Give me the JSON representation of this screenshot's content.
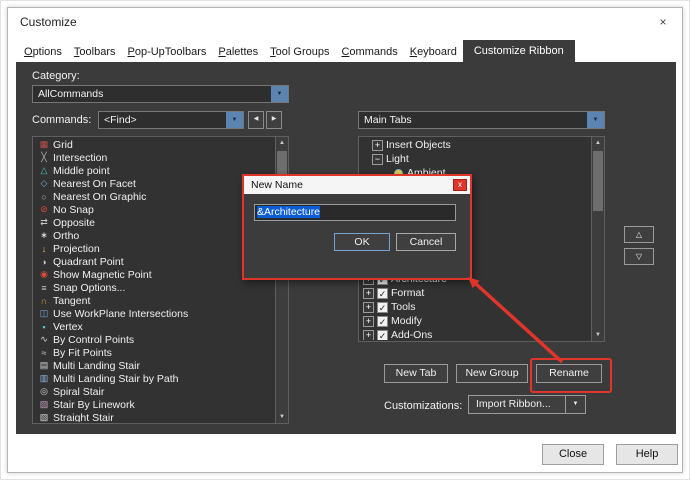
{
  "window": {
    "title": "Customize",
    "close_glyph": "×"
  },
  "tabs": {
    "inactive": [
      "Options",
      "Toolbars",
      "Pop-UpToolbars",
      "Palettes",
      "Tool Groups",
      "Commands",
      "Keyboard"
    ],
    "active": "Customize Ribbon"
  },
  "icons": {
    "drop": "▼",
    "prev": "◀",
    "next": "▶",
    "scroll_up": "▲",
    "scroll_down": "▼",
    "move_up": "△",
    "move_down": "▽",
    "check": "✓"
  },
  "left": {
    "category_label": "Category:",
    "category_value": "AllCommands",
    "commands_label": "Commands:",
    "find_value": "<Find>",
    "commands": [
      {
        "name": "grid",
        "label": "Grid",
        "glyph": "▦",
        "color": "#c0504d"
      },
      {
        "name": "intersection",
        "label": "Intersection",
        "glyph": "╳",
        "color": "#b8b8b8"
      },
      {
        "name": "middle-point",
        "label": "Middle point",
        "glyph": "△",
        "color": "#52c5c5"
      },
      {
        "name": "nearest-on-facet",
        "label": "Nearest On Facet",
        "glyph": "◇",
        "color": "#86a8c8"
      },
      {
        "name": "nearest-on-graphic",
        "label": "Nearest On Graphic",
        "glyph": "○",
        "color": "#b8b8b8"
      },
      {
        "name": "no-snap",
        "label": "No Snap",
        "glyph": "⊘",
        "color": "#e04a3a"
      },
      {
        "name": "opposite",
        "label": "Opposite",
        "glyph": "⇄",
        "color": "#c8c8c8"
      },
      {
        "name": "ortho",
        "label": "Ortho",
        "glyph": "∗",
        "color": "#e8e8e8"
      },
      {
        "name": "projection",
        "label": "Projection",
        "glyph": "↓",
        "color": "#e2c24a"
      },
      {
        "name": "quadrant-point",
        "label": "Quadrant Point",
        "glyph": "◑",
        "color": "#c8c8c8"
      },
      {
        "name": "show-magnetic-point",
        "label": "Show Magnetic Point",
        "glyph": "◉",
        "color": "#e04a3a"
      },
      {
        "name": "snap-options",
        "label": "Snap Options...",
        "glyph": "≡",
        "color": "#c8c8c8"
      },
      {
        "name": "tangent",
        "label": "Tangent",
        "glyph": "∩",
        "color": "#e2a23a"
      },
      {
        "name": "use-workplane-intersections",
        "label": "Use WorkPlane Intersections",
        "glyph": "◫",
        "color": "#7fa8d8"
      },
      {
        "name": "vertex",
        "label": "Vertex",
        "glyph": "▪",
        "color": "#52c5c5"
      },
      {
        "name": "by-control-points",
        "label": "By Control Points",
        "glyph": "∿",
        "color": "#d8d8d8"
      },
      {
        "name": "by-fit-points",
        "label": "By Fit Points",
        "glyph": "≈",
        "color": "#c8c8c8"
      },
      {
        "name": "multi-landing-stair",
        "label": "Multi Landing Stair",
        "glyph": "▤",
        "color": "#d8d8d8"
      },
      {
        "name": "multi-landing-stair-by-path",
        "label": "Multi Landing Stair by Path",
        "glyph": "▥",
        "color": "#8fb7e0"
      },
      {
        "name": "spiral-stair",
        "label": "Spiral Stair",
        "glyph": "◎",
        "color": "#d8d8d8"
      },
      {
        "name": "stair-by-linework",
        "label": "Stair By Linework",
        "glyph": "▨",
        "color": "#c0a0c0"
      },
      {
        "name": "straight-stair",
        "label": "Straight Stair",
        "glyph": "▧",
        "color": "#d8d8d8"
      }
    ]
  },
  "right": {
    "target_combo_value": "Main Tabs",
    "tree_top": [
      {
        "label": "Insert Objects",
        "expander": "+",
        "level": 1
      },
      {
        "label": "Light",
        "expander": "−",
        "level": 1
      },
      {
        "label": "Ambient",
        "bullet": true,
        "level": 2
      }
    ],
    "tree_bottom": [
      {
        "label": "Architecture",
        "expander": "+",
        "checked": true
      },
      {
        "label": "Format",
        "expander": "+",
        "checked": true
      },
      {
        "label": "Tools",
        "expander": "+",
        "checked": true
      },
      {
        "label": "Modify",
        "expander": "+",
        "checked": true
      },
      {
        "label": "Add-Ons",
        "expander": "+",
        "checked": true
      }
    ],
    "new_tab": "New Tab",
    "new_group": "New Group",
    "rename": "Rename",
    "customizations_label": "Customizations:",
    "import_button": "Import Ribbon..."
  },
  "newname_dialog": {
    "title": "New Name",
    "close_glyph": "x",
    "value": "&Architecture",
    "ok": "OK",
    "cancel": "Cancel"
  },
  "footer": {
    "close": "Close",
    "help": "Help"
  },
  "colors": {
    "annotation": "#e0352b",
    "selection": "#0b5cd5",
    "accent": "#5b84b1",
    "panel": "#3b3b3b"
  }
}
